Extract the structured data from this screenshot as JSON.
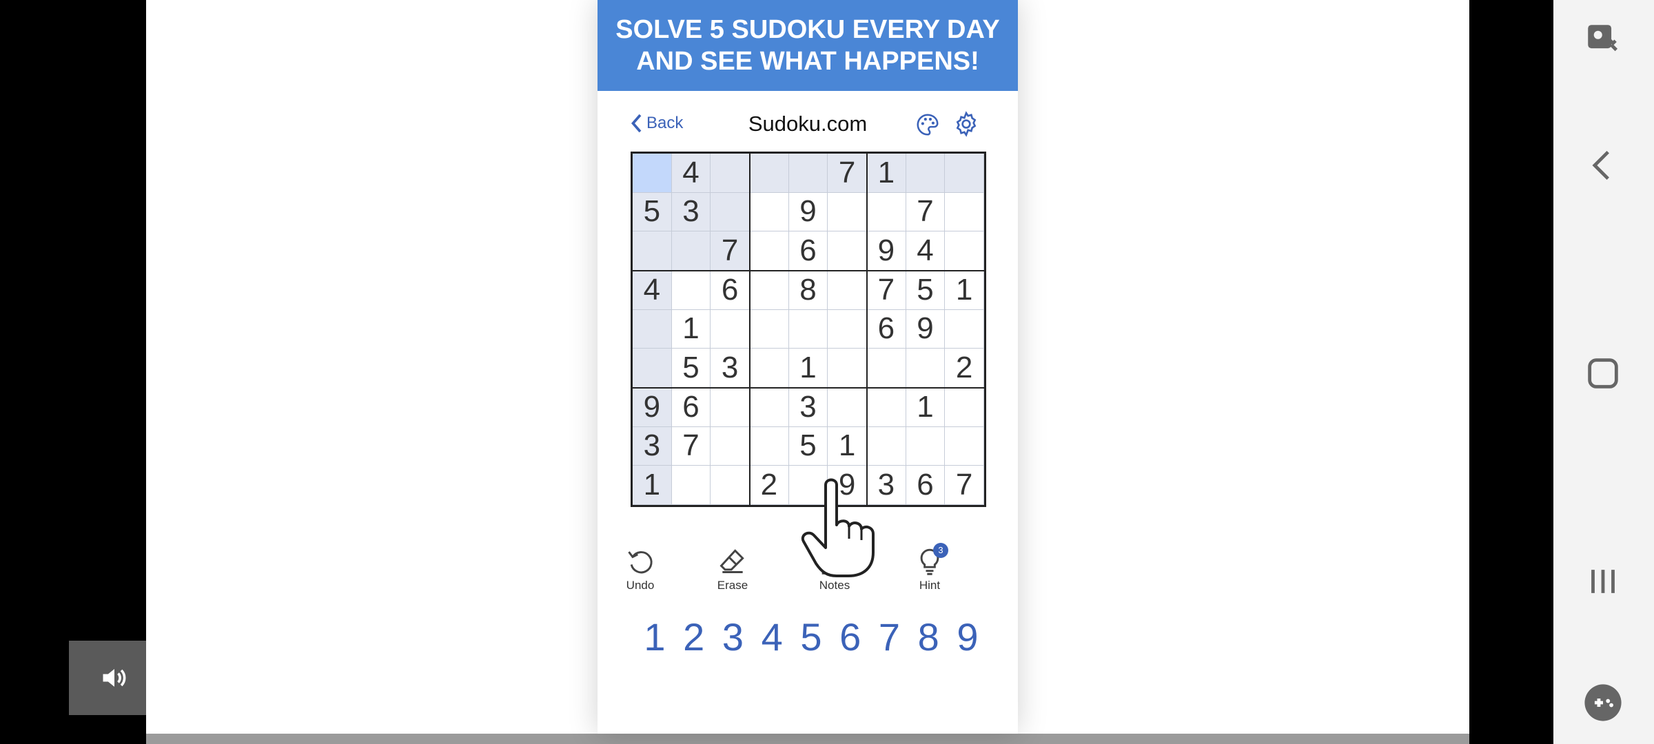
{
  "banner": {
    "line1": "SOLVE 5 SUDOKU EVERY DAY",
    "line2": "AND SEE WHAT HAPPENS!"
  },
  "header": {
    "back_label": "Back",
    "title": "Sudoku.com"
  },
  "board": {
    "grid": [
      [
        "",
        "4",
        "",
        "",
        "",
        "7",
        "1",
        "",
        ""
      ],
      [
        "5",
        "3",
        "",
        "",
        "9",
        "",
        "",
        "7",
        ""
      ],
      [
        "",
        "",
        "7",
        "",
        "6",
        "",
        "9",
        "4",
        ""
      ],
      [
        "4",
        "",
        "6",
        "",
        "8",
        "",
        "7",
        "5",
        "1"
      ],
      [
        "",
        "1",
        "",
        "",
        "",
        "",
        "6",
        "9",
        ""
      ],
      [
        "",
        "5",
        "3",
        "",
        "1",
        "",
        "",
        "",
        "2"
      ],
      [
        "9",
        "6",
        "",
        "",
        "3",
        "",
        "",
        "1",
        ""
      ],
      [
        "3",
        "7",
        "",
        "",
        "5",
        "1",
        "",
        "",
        ""
      ],
      [
        "1",
        "",
        "",
        "2",
        "",
        "9",
        "3",
        "6",
        "7"
      ]
    ],
    "selected": {
      "row": 0,
      "col": 0
    }
  },
  "tools": {
    "undo": "Undo",
    "erase": "Erase",
    "notes": "Notes",
    "notes_state": "Off",
    "hint": "Hint",
    "hint_count": "3"
  },
  "numpad": [
    "1",
    "2",
    "3",
    "4",
    "5",
    "6",
    "7",
    "8",
    "9"
  ],
  "colors": {
    "banner": "#4a86d6",
    "accent": "#3b62b8",
    "selected": "#c3d8fb",
    "highlight": "#e3e7f1"
  }
}
